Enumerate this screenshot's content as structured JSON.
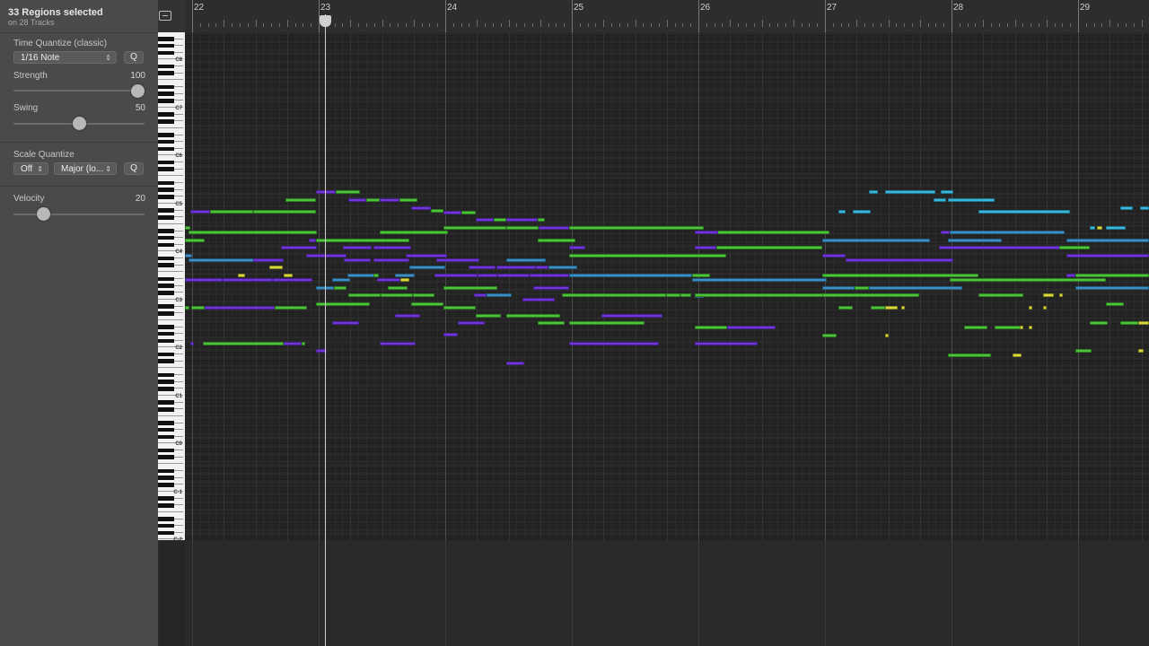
{
  "selection": {
    "title": "33 Regions selected",
    "subtitle": "on 28 Tracks"
  },
  "time_quantize": {
    "label": "Time Quantize (classic)",
    "value": "1/16 Note",
    "q_label": "Q",
    "strength_label": "Strength",
    "strength_value": "100",
    "strength_level": 1.0,
    "swing_label": "Swing",
    "swing_value": "50",
    "swing_level": 0.5
  },
  "scale_quantize": {
    "label": "Scale Quantize",
    "value": "Off",
    "scale": "Major (lo...",
    "q_label": "Q"
  },
  "velocity": {
    "label": "Velocity",
    "value": "20",
    "level": 0.2
  },
  "ruler": {
    "bars": [
      "22",
      "23",
      "24",
      "25",
      "26",
      "27",
      "28",
      "29"
    ]
  },
  "keyboard": {
    "octave_labels": [
      "C8",
      "C7",
      "C6",
      "C5",
      "C4",
      "C3",
      "C2",
      "C1",
      "C0",
      "C-1",
      "C-2"
    ]
  },
  "colors": {
    "green": "#4cc43a",
    "purple": "#6f35d8",
    "blue": "#3b8fc4",
    "cyan": "#36b8dc",
    "yellow": "#d8d83a"
  }
}
